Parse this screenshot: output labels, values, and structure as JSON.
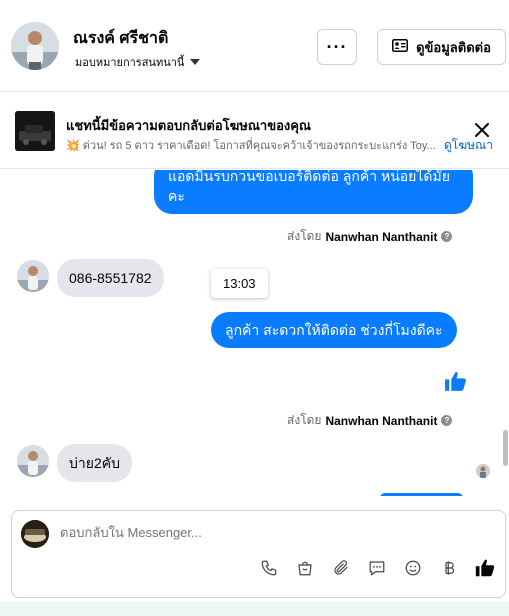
{
  "header": {
    "contact_name": "ณรงค์ ศรีชาติ",
    "assignment": "มอบหมายการสนทนานี้",
    "more_label": "···",
    "info_label": "ดูข้อมูลติดต่อ"
  },
  "ad": {
    "title": "แชทนี้มีข้อความตอบกลับต่อโฆษณาของคุณ",
    "preview": "💥 ด่วน! รถ 5 ดาว ราคาเดือด! โอกาสที่คุณจะคว้าเจ้าของรถกระบะแกร่ง Toy...",
    "link": "ดูโฆษณา"
  },
  "messages": {
    "out1": "แอดมินรบกวนขอเบอร์ติดต่อ ลูกค้า  หน่อยได้มั้ยคะ",
    "sent_by_prefix": "ส่งโดย",
    "sent_by_name": "Nanwhan Nanthanit",
    "in1": "086-8551782",
    "time": "13:03",
    "out2": "ลูกค้า  สะดวกให้ติดต่อ ช่วงกี่โมงดีคะ",
    "sent_by2_prefix": "ส่งโดย",
    "sent_by2_name": "Nanwhan Nanthanit",
    "in2": "บ่าย2คับ"
  },
  "composer": {
    "placeholder": "ตอบกลับใน Messenger..."
  },
  "colors": {
    "accent": "#0a7cff",
    "link": "#0064d1",
    "incoming_bubble": "#e4e6eb"
  }
}
